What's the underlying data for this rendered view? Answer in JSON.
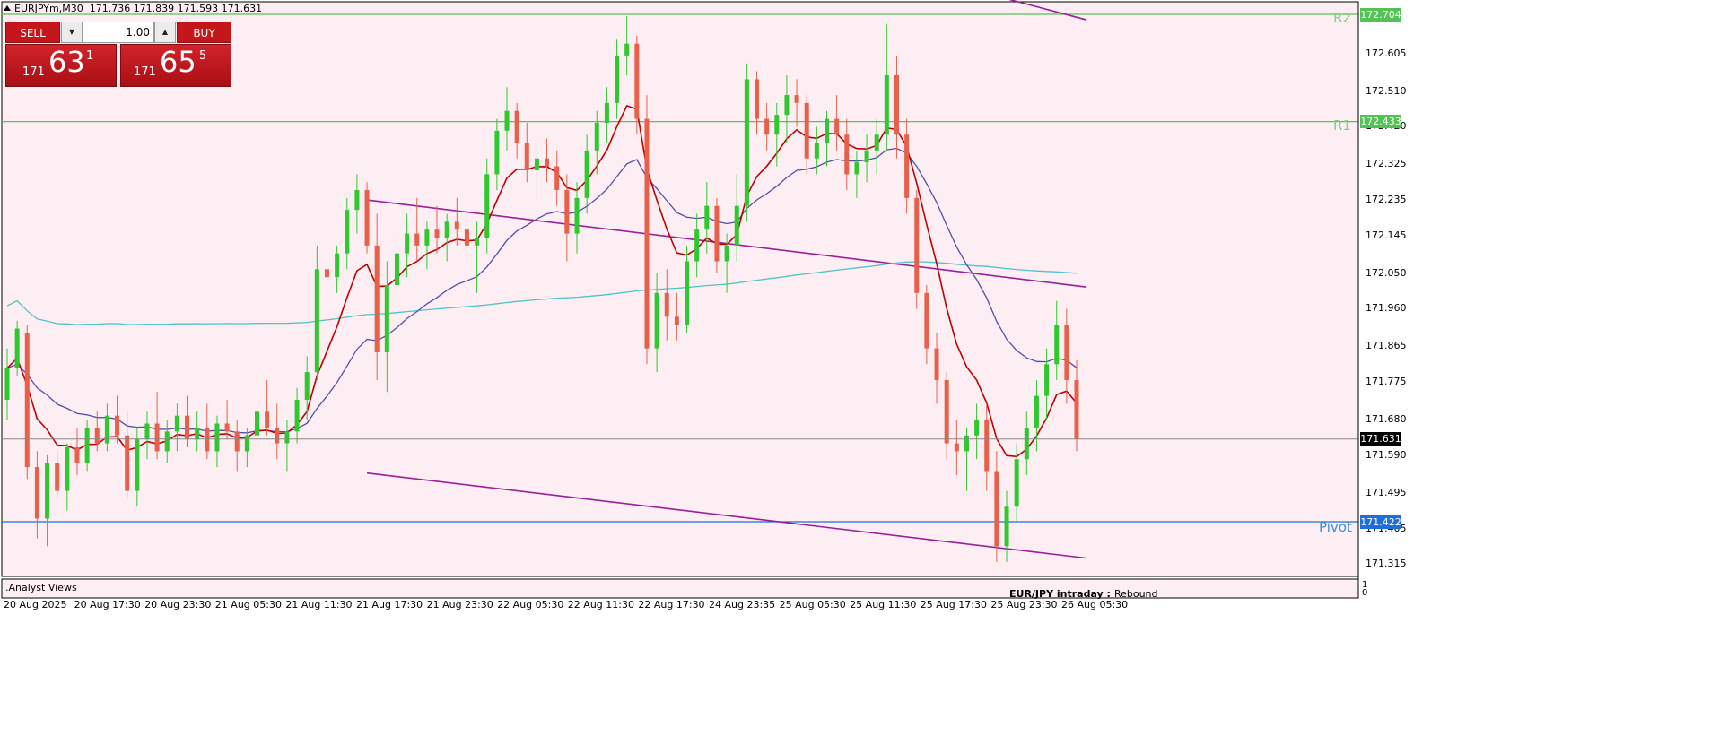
{
  "header": {
    "symbol": "EURJPYm,M30",
    "ohlc": "171.736 171.839 171.593 171.631"
  },
  "trade_panel": {
    "sell_label": "SELL",
    "buy_label": "BUY",
    "volume": "1.00",
    "sell_price": {
      "small": "171",
      "big": "63",
      "sup": "1"
    },
    "buy_price": {
      "small": "171",
      "big": "65",
      "sup": "5"
    }
  },
  "levels": {
    "r2": {
      "label": "R2",
      "value": "172.704",
      "color": "#55c255"
    },
    "r1": {
      "label": "R1",
      "value": "172.433",
      "color": "#55c255"
    },
    "pivot": {
      "label": "Pivot",
      "value": "171.422",
      "color": "#1e6fd9"
    },
    "current": {
      "value": "171.631"
    }
  },
  "price_axis": [
    "172.605",
    "172.510",
    "172.420",
    "172.325",
    "172.235",
    "172.145",
    "172.050",
    "171.960",
    "171.865",
    "171.775",
    "171.680",
    "171.590",
    "171.495",
    "171.405",
    "171.315"
  ],
  "time_axis": [
    "20 Aug 2025",
    "20 Aug 17:30",
    "20 Aug 23:30",
    "21 Aug 05:30",
    "21 Aug 11:30",
    "21 Aug 17:30",
    "21 Aug 23:30",
    "22 Aug 05:30",
    "22 Aug 11:30",
    "22 Aug 17:30",
    "24 Aug 23:35",
    "25 Aug 05:30",
    "25 Aug 11:30",
    "25 Aug 17:30",
    "25 Aug 23:30",
    "26 Aug 05:30"
  ],
  "indicator_panel": {
    "name": ".Analyst Views",
    "scale_max": "1",
    "scale_min": "0"
  },
  "note": {
    "label": "EUR/JPY intraday :",
    "value": "Rebound"
  },
  "colors": {
    "chart_bg": "#fdeef3",
    "bull": "#2ec92e",
    "bear": "#e8604a",
    "ma_fast": "#c00000",
    "ma_mid": "#5050a8",
    "ma_slow": "#4fc4c4",
    "channel": "#9a1f9a",
    "grid_frame": "#000000"
  },
  "chart_data": {
    "type": "candlestick",
    "symbol": "EURJPYm",
    "timeframe": "M30",
    "ylim": [
      171.29,
      172.76
    ],
    "candles": [
      [
        171.73,
        171.86,
        171.68,
        171.81
      ],
      [
        171.81,
        171.93,
        171.79,
        171.91
      ],
      [
        171.9,
        171.92,
        171.53,
        171.56
      ],
      [
        171.56,
        171.6,
        171.38,
        171.43
      ],
      [
        171.43,
        171.59,
        171.36,
        171.57
      ],
      [
        171.57,
        171.6,
        171.48,
        171.5
      ],
      [
        171.5,
        171.62,
        171.45,
        171.61
      ],
      [
        171.61,
        171.66,
        171.54,
        171.57
      ],
      [
        171.57,
        171.68,
        171.55,
        171.66
      ],
      [
        171.66,
        171.7,
        171.6,
        171.62
      ],
      [
        171.62,
        171.72,
        171.6,
        171.69
      ],
      [
        171.69,
        171.74,
        171.62,
        171.64
      ],
      [
        171.64,
        171.7,
        171.48,
        171.5
      ],
      [
        171.5,
        171.66,
        171.46,
        171.63
      ],
      [
        171.63,
        171.7,
        171.58,
        171.67
      ],
      [
        171.67,
        171.75,
        171.58,
        171.6
      ],
      [
        171.6,
        171.68,
        171.57,
        171.65
      ],
      [
        171.65,
        171.72,
        171.6,
        171.69
      ],
      [
        171.69,
        171.74,
        171.61,
        171.63
      ],
      [
        171.63,
        171.7,
        171.6,
        171.66
      ],
      [
        171.66,
        171.72,
        171.58,
        171.6
      ],
      [
        171.6,
        171.69,
        171.56,
        171.67
      ],
      [
        171.67,
        171.73,
        171.63,
        171.65
      ],
      [
        171.65,
        171.68,
        171.55,
        171.6
      ],
      [
        171.6,
        171.66,
        171.56,
        171.64
      ],
      [
        171.64,
        171.74,
        171.6,
        171.7
      ],
      [
        171.7,
        171.78,
        171.64,
        171.66
      ],
      [
        171.66,
        171.72,
        171.58,
        171.62
      ],
      [
        171.62,
        171.68,
        171.55,
        171.65
      ],
      [
        171.65,
        171.76,
        171.62,
        171.73
      ],
      [
        171.73,
        171.84,
        171.68,
        171.8
      ],
      [
        171.8,
        172.12,
        171.78,
        172.06
      ],
      [
        172.06,
        172.17,
        171.98,
        172.04
      ],
      [
        172.04,
        172.12,
        172.0,
        172.1
      ],
      [
        172.1,
        172.24,
        172.06,
        172.21
      ],
      [
        172.21,
        172.3,
        172.15,
        172.26
      ],
      [
        172.26,
        172.28,
        172.1,
        172.12
      ],
      [
        172.12,
        172.2,
        171.78,
        171.85
      ],
      [
        171.85,
        172.08,
        171.75,
        172.02
      ],
      [
        172.02,
        172.14,
        171.98,
        172.1
      ],
      [
        172.1,
        172.2,
        172.04,
        172.15
      ],
      [
        172.15,
        172.24,
        172.08,
        172.12
      ],
      [
        172.12,
        172.18,
        172.06,
        172.16
      ],
      [
        172.16,
        172.22,
        172.1,
        172.14
      ],
      [
        172.14,
        172.2,
        172.08,
        172.18
      ],
      [
        172.18,
        172.24,
        172.12,
        172.16
      ],
      [
        172.16,
        172.2,
        172.08,
        172.12
      ],
      [
        172.12,
        172.18,
        172.0,
        172.14
      ],
      [
        172.14,
        172.34,
        172.1,
        172.3
      ],
      [
        172.3,
        172.44,
        172.26,
        172.41
      ],
      [
        172.41,
        172.52,
        172.36,
        172.46
      ],
      [
        172.46,
        172.48,
        172.34,
        172.38
      ],
      [
        172.38,
        172.43,
        172.28,
        172.31
      ],
      [
        172.31,
        172.38,
        172.24,
        172.34
      ],
      [
        172.34,
        172.39,
        172.28,
        172.32
      ],
      [
        172.32,
        172.36,
        172.22,
        172.26
      ],
      [
        172.26,
        172.3,
        172.08,
        172.15
      ],
      [
        172.15,
        172.28,
        172.1,
        172.24
      ],
      [
        172.24,
        172.4,
        172.2,
        172.36
      ],
      [
        172.36,
        172.46,
        172.3,
        172.43
      ],
      [
        172.43,
        172.52,
        172.38,
        172.48
      ],
      [
        172.48,
        172.64,
        172.44,
        172.6
      ],
      [
        172.6,
        172.7,
        172.55,
        172.63
      ],
      [
        172.63,
        172.65,
        172.4,
        172.44
      ],
      [
        172.44,
        172.5,
        171.82,
        171.86
      ],
      [
        171.86,
        172.05,
        171.8,
        172.0
      ],
      [
        172.0,
        172.06,
        171.88,
        171.94
      ],
      [
        171.94,
        172.0,
        171.88,
        171.92
      ],
      [
        171.92,
        172.12,
        171.9,
        172.08
      ],
      [
        172.08,
        172.2,
        172.04,
        172.16
      ],
      [
        172.16,
        172.28,
        172.1,
        172.22
      ],
      [
        172.22,
        172.24,
        172.05,
        172.08
      ],
      [
        172.08,
        172.15,
        172.0,
        172.12
      ],
      [
        172.12,
        172.3,
        172.08,
        172.22
      ],
      [
        172.22,
        172.58,
        172.18,
        172.54
      ],
      [
        172.54,
        172.56,
        172.4,
        172.44
      ],
      [
        172.44,
        172.48,
        172.36,
        172.4
      ],
      [
        172.4,
        172.48,
        172.32,
        172.45
      ],
      [
        172.45,
        172.55,
        172.38,
        172.5
      ],
      [
        172.5,
        172.54,
        172.42,
        172.48
      ],
      [
        172.48,
        172.5,
        172.3,
        172.34
      ],
      [
        172.34,
        172.42,
        172.3,
        172.38
      ],
      [
        172.38,
        172.46,
        172.32,
        172.44
      ],
      [
        172.44,
        172.5,
        172.36,
        172.4
      ],
      [
        172.4,
        172.44,
        172.26,
        172.3
      ],
      [
        172.3,
        172.36,
        172.24,
        172.33
      ],
      [
        172.33,
        172.4,
        172.28,
        172.36
      ],
      [
        172.36,
        172.44,
        172.3,
        172.4
      ],
      [
        172.4,
        172.68,
        172.36,
        172.55
      ],
      [
        172.55,
        172.6,
        172.34,
        172.4
      ],
      [
        172.4,
        172.44,
        172.2,
        172.24
      ],
      [
        172.24,
        172.26,
        171.96,
        172.0
      ],
      [
        172.0,
        172.02,
        171.82,
        171.86
      ],
      [
        171.86,
        171.9,
        171.72,
        171.78
      ],
      [
        171.78,
        171.8,
        171.58,
        171.62
      ],
      [
        171.62,
        171.68,
        171.54,
        171.6
      ],
      [
        171.6,
        171.66,
        171.5,
        171.64
      ],
      [
        171.64,
        171.72,
        171.58,
        171.68
      ],
      [
        171.68,
        171.72,
        171.5,
        171.55
      ],
      [
        171.55,
        171.6,
        171.32,
        171.36
      ],
      [
        171.36,
        171.5,
        171.32,
        171.46
      ],
      [
        171.46,
        171.62,
        171.42,
        171.58
      ],
      [
        171.58,
        171.7,
        171.54,
        171.66
      ],
      [
        171.66,
        171.78,
        171.6,
        171.74
      ],
      [
        171.74,
        171.86,
        171.68,
        171.82
      ],
      [
        171.82,
        171.98,
        171.78,
        171.92
      ],
      [
        171.92,
        171.96,
        171.72,
        171.78
      ],
      [
        171.78,
        171.83,
        171.6,
        171.63
      ]
    ]
  }
}
